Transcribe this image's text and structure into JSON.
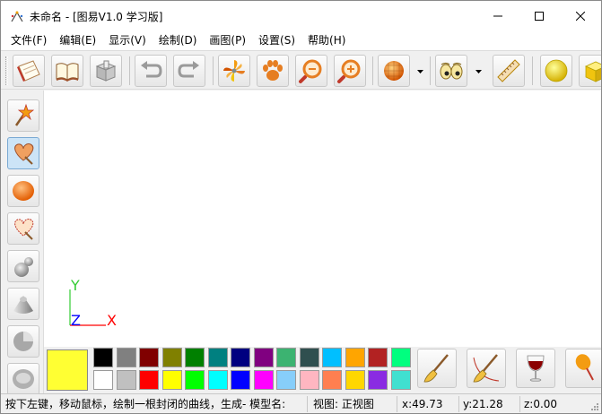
{
  "window": {
    "title": "未命名 - [图易V1.0 学习版]"
  },
  "menubar": {
    "items": [
      "文件(F)",
      "编辑(E)",
      "显示(V)",
      "绘制(D)",
      "画图(P)",
      "设置(S)",
      "帮助(H)"
    ]
  },
  "toolbar": {
    "buttons": [
      {
        "name": "new-document-icon"
      },
      {
        "name": "open-book-icon"
      },
      {
        "name": "save-box-icon"
      },
      {
        "name": "undo-icon"
      },
      {
        "name": "redo-icon"
      },
      {
        "name": "pinwheel-icon"
      },
      {
        "name": "paw-icon"
      },
      {
        "name": "zoom-out-icon"
      },
      {
        "name": "zoom-in-icon"
      },
      {
        "name": "shaded-sphere-icon"
      },
      {
        "name": "eyes-icon"
      },
      {
        "name": "ruler-icon"
      },
      {
        "name": "yellow-sphere-icon"
      },
      {
        "name": "yellow-cube-icon"
      }
    ]
  },
  "lefttoolbar": {
    "buttons": [
      {
        "name": "magic-wand-icon"
      },
      {
        "name": "closed-curve-icon"
      },
      {
        "name": "orange-ellipse-icon"
      },
      {
        "name": "open-curve-icon"
      },
      {
        "name": "gray-spheres-icon"
      },
      {
        "name": "gray-cone-icon"
      },
      {
        "name": "gray-pie-icon"
      },
      {
        "name": "gray-disk-icon"
      }
    ]
  },
  "canvas": {
    "axis_y_label": "Y",
    "axis_z_label": "Z",
    "axis_x_label": "X",
    "axis_colors": {
      "x": "#ff0000",
      "y": "#33cc33",
      "z": "#0000ff"
    }
  },
  "palette": {
    "current_color": "#ffff33",
    "top_row": [
      "#000000",
      "#808080",
      "#800000",
      "#808000",
      "#008000",
      "#008080",
      "#000080",
      "#800080",
      "#3cb371",
      "#2f4f4f",
      "#00bfff",
      "#ffa500",
      "#b22222",
      "#00ff7f"
    ],
    "bottom_row": [
      "#ffffff",
      "#c0c0c0",
      "#ff0000",
      "#ffff00",
      "#00ff00",
      "#00ffff",
      "#0000ff",
      "#ff00ff",
      "#87cefa",
      "#ffb6c1",
      "#ff7f50",
      "#ffd700",
      "#8a2be2",
      "#40e0d0"
    ],
    "brush_buttons": [
      {
        "name": "brush-icon"
      },
      {
        "name": "brush-curve-icon"
      },
      {
        "name": "wine-glass-icon"
      },
      {
        "name": "ice-cream-icon"
      }
    ]
  },
  "statusbar": {
    "message": "按下左键，移动鼠标，绘制一根封闭的曲线，生成- 模型名:",
    "view": "视图: 正视图",
    "x": "x:49.73",
    "y": "y:21.28",
    "z": "z:0.00"
  }
}
